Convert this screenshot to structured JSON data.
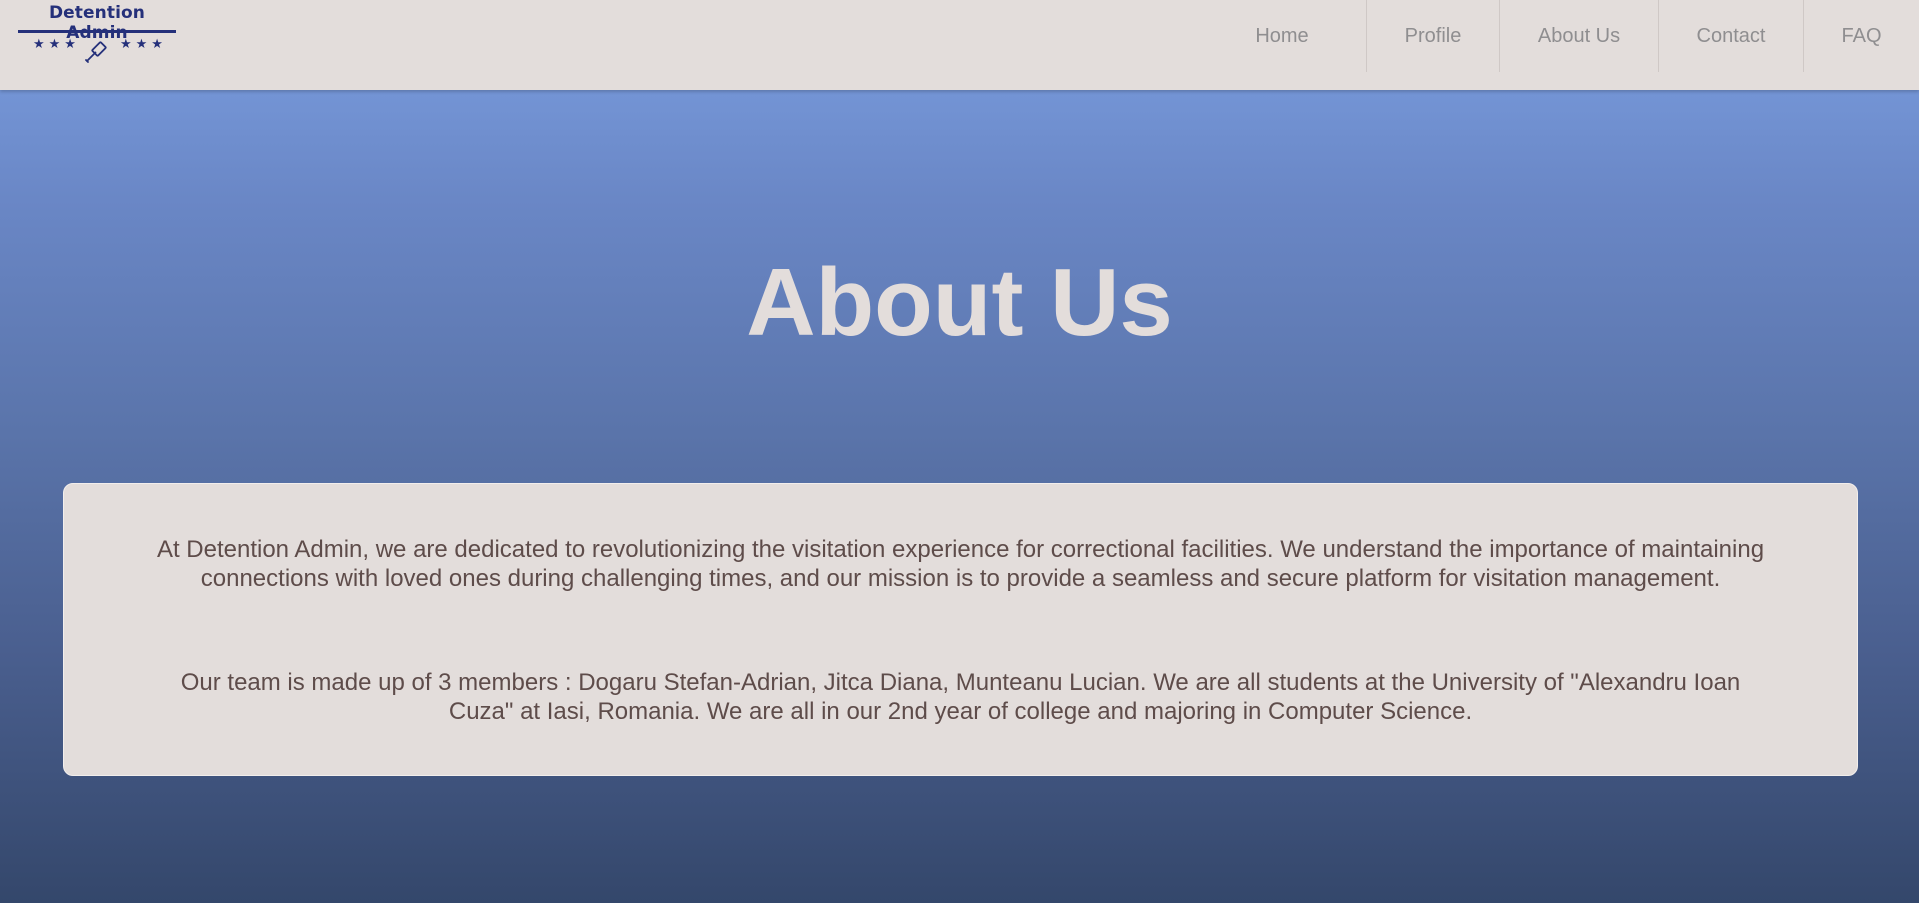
{
  "brand": {
    "name": "Detention Admin",
    "stars_left": "★★★",
    "stars_right": "★★★",
    "logo_icon": "gavel-icon",
    "color": "#25307a"
  },
  "nav": {
    "items": [
      {
        "label": "Home"
      },
      {
        "label": "Profile"
      },
      {
        "label": "About Us"
      },
      {
        "label": "Contact"
      },
      {
        "label": "FAQ"
      }
    ]
  },
  "page": {
    "title": "About Us",
    "paragraphs": [
      "At Detention Admin, we are dedicated to revolutionizing the visitation experience for correctional facilities. We understand the importance of maintaining connections with loved ones during challenging times, and our mission is to provide a seamless and secure platform for visitation management.",
      "Our team is made up of 3 members : Dogaru Stefan-Adrian, Jitca Diana, Munteanu Lucian. We are all students at the University of \"Alexandru Ioan Cuza\" at Iasi, Romania. We are all in our 2nd year of college and majoring in Computer Science."
    ]
  },
  "colors": {
    "header_bg": "#e3dddb",
    "nav_text": "#8f8e90",
    "title_text": "#e3dddb",
    "card_bg": "#e3dddb",
    "card_text": "#5e4c4a",
    "gradient_top": "#7b9fe1",
    "gradient_bottom": "#34476b"
  }
}
